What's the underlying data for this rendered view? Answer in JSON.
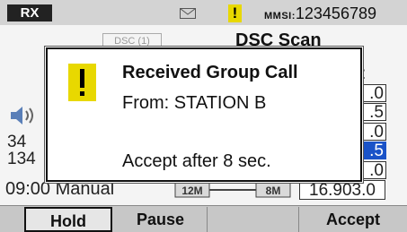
{
  "status_bar": {
    "rx_label": "RX",
    "mail_icon": "envelope-icon",
    "alert_icon": "warning-icon",
    "alert_glyph": "!",
    "mmsi_label": "MMSI:",
    "mmsi_value": "123456789"
  },
  "background": {
    "dsc_tag": "DSC (1)",
    "title": "DSC Scan",
    "speaker_icon": "speaker-icon",
    "colon": ":",
    "right_column": [
      ".0",
      ".5",
      ".0",
      ".5",
      ".0"
    ],
    "left_channels": [
      "34",
      "134"
    ],
    "time_mode": "09:00 Manual",
    "range_low": "12M",
    "range_high": "8M",
    "frequency": "16.903.0"
  },
  "popup": {
    "icon": "warning-icon",
    "title": "Received Group Call",
    "from": "From: STATION B",
    "accept_text": "Accept after 8 sec."
  },
  "softkeys": {
    "hold": "Hold",
    "pause": "Pause",
    "blank": "",
    "accept": "Accept"
  },
  "colors": {
    "warning_yellow": "#e8d800",
    "status_bar": "#d3d3d3",
    "softkey_bar": "#c7c7c7",
    "highlight_blue": "#1a53c8"
  }
}
